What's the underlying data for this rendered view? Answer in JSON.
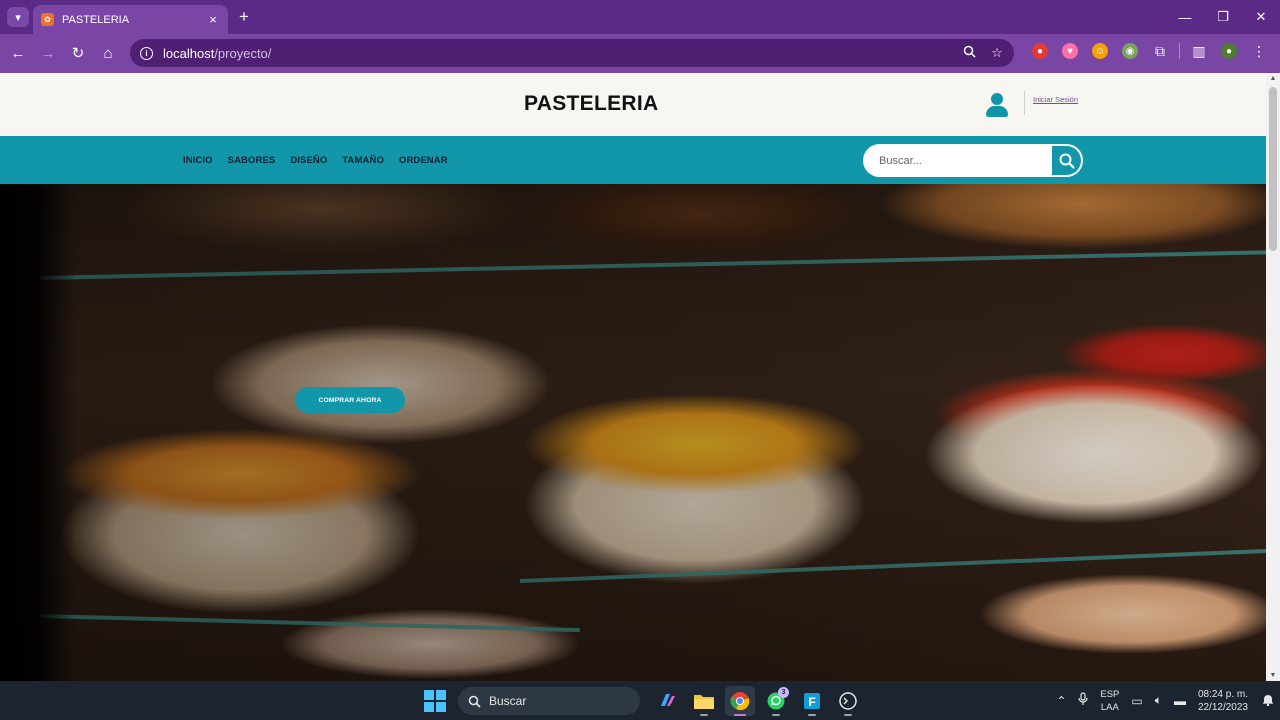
{
  "browser": {
    "tab_title": "PASTELERIA",
    "tab_favicon": "xampp-icon",
    "url_host": "localhost",
    "url_path": "/proyecto/",
    "new_tab_label": "+",
    "close_tab_label": "×"
  },
  "site": {
    "brand": "PASTELERIA",
    "login_label": "Iniciar Sesión",
    "menu": [
      {
        "label": "INICIO"
      },
      {
        "label": "SABORES"
      },
      {
        "label": "DISEÑO"
      },
      {
        "label": "TAMAÑO"
      },
      {
        "label": "ORDENAR"
      }
    ],
    "search_placeholder": "Buscar...",
    "cta_label": "COMPRAR AHORA",
    "accent_color": "#1296aa",
    "header_bg": "#f8f6f0"
  },
  "taskbar": {
    "search_label": "Buscar",
    "whatsapp_badge": "3",
    "lang_line1": "ESP",
    "lang_line2": "LAA",
    "time": "08:24 p. m.",
    "date": "22/12/2023"
  },
  "colors": {
    "chrome_title": "#5b2a86",
    "chrome_toolbar": "#7a46a6",
    "taskbar": "#1c2430"
  }
}
